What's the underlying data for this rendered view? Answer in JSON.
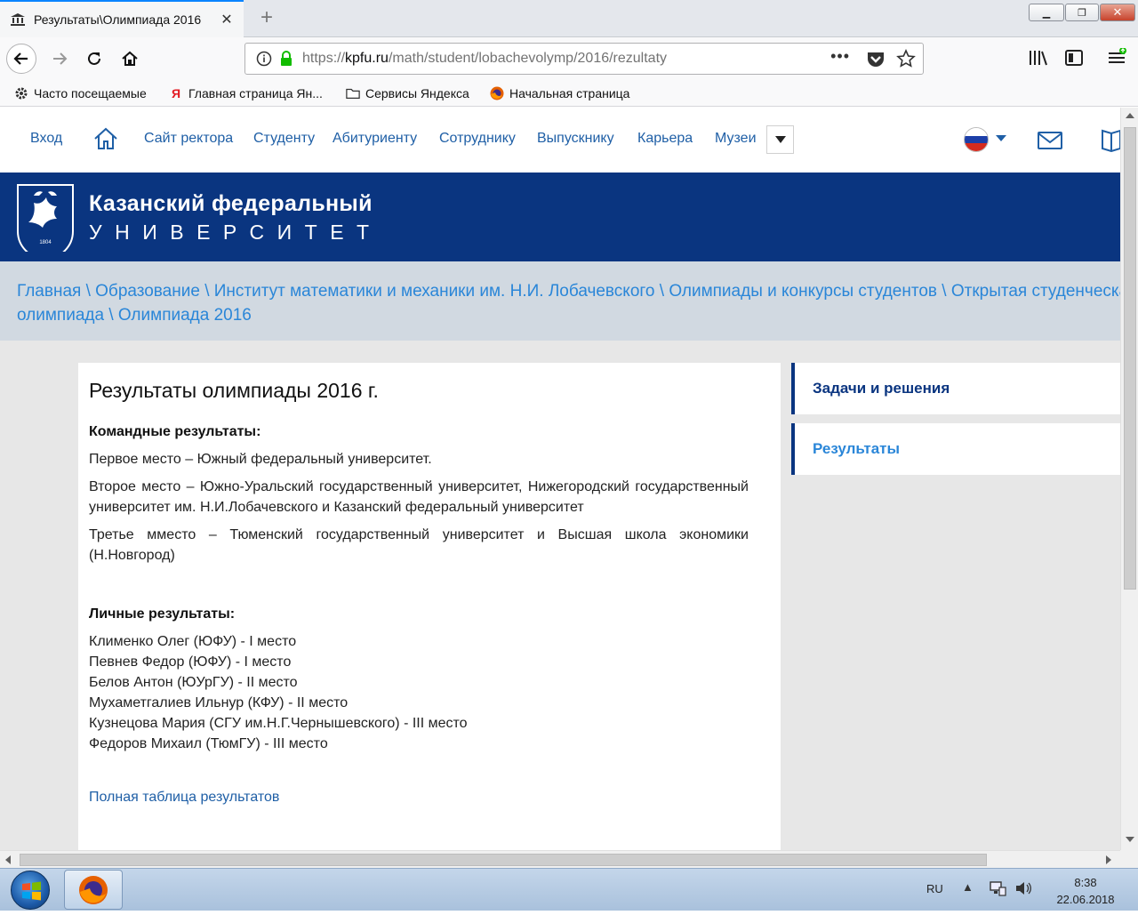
{
  "browser": {
    "tab_title": "Результаты\\Олимпиада 2016",
    "url_scheme": "https://",
    "url_host": "kpfu.ru",
    "url_path": "/math/student/lobachevolymp/2016/rezultaty",
    "bookmarks": [
      "Часто посещаемые",
      "Главная страница Ян...",
      "Сервисы Яндекса",
      "Начальная страница"
    ]
  },
  "site": {
    "topnav": [
      "Вход",
      "Сайт ректора",
      "Студенту",
      "Абитуриенту",
      "Сотруднику",
      "Выпускнику",
      "Карьера",
      "Музеи"
    ],
    "brand_line1": "Казанский федеральный",
    "brand_line2": "УНИВЕРСИТЕТ",
    "logo_year": "1804",
    "breadcrumb_line1": "Главная \\ Образование \\ Институт математики и механики им. Н.И. Лобачевского \\ Олимпиады и конкурсы студентов \\ Открытая студенческая",
    "breadcrumb_line2": "олимпиада \\ Олимпиада 2016",
    "accent_color": "#0a3580",
    "link_color": "#2a86d8"
  },
  "content": {
    "title": "Результаты олимпиады 2016 г.",
    "team_heading": "Командные результаты:",
    "team_results": [
      "Первое место – Южный федеральный университет.",
      "Второе место – Южно-Уральский государственный университет, Нижегородский государственный университет им. Н.И.Лобачевского и Казанский федеральный университет",
      "Третье мместо – Тюменский государственный университет и Высшая школа экономики (Н.Новгород)"
    ],
    "personal_heading": "Личные результаты:",
    "personal_results": [
      "Клименко Олег (ЮФУ) - I место",
      "Певнев Федор (ЮФУ) - I место",
      "Белов Антон (ЮУрГУ) - II место",
      "Мухаметгалиев Ильнур (КФУ) - II место",
      "Кузнецова Мария (СГУ им.Н.Г.Чернышевского) - III место",
      "Федоров Михаил (ТюмГУ) - III место"
    ],
    "full_table_link": "Полная таблица результатов"
  },
  "sidebar": {
    "items": [
      "Задачи и решения",
      "Результаты"
    ]
  },
  "taskbar": {
    "lang": "RU",
    "time": "8:38",
    "date": "22.06.2018"
  }
}
